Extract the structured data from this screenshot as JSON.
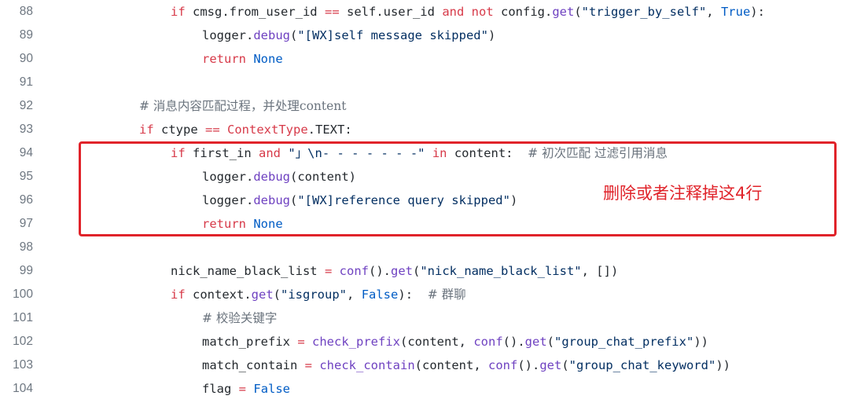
{
  "lines": [
    {
      "num": "88",
      "indent": 2,
      "tokens": [
        {
          "t": "if",
          "c": "kw"
        },
        {
          "t": " cmsg.from_user_id ",
          "c": ""
        },
        {
          "t": "==",
          "c": "op"
        },
        {
          "t": " self.user_id ",
          "c": ""
        },
        {
          "t": "and",
          "c": "kw"
        },
        {
          "t": " ",
          "c": ""
        },
        {
          "t": "not",
          "c": "kw"
        },
        {
          "t": " config.",
          "c": ""
        },
        {
          "t": "get",
          "c": "fn"
        },
        {
          "t": "(",
          "c": ""
        },
        {
          "t": "\"trigger_by_self\"",
          "c": "str"
        },
        {
          "t": ", ",
          "c": ""
        },
        {
          "t": "True",
          "c": "bi"
        },
        {
          "t": "):",
          "c": ""
        }
      ]
    },
    {
      "num": "89",
      "indent": 3,
      "tokens": [
        {
          "t": "logger.",
          "c": ""
        },
        {
          "t": "debug",
          "c": "fn"
        },
        {
          "t": "(",
          "c": ""
        },
        {
          "t": "\"[WX]self message skipped\"",
          "c": "str"
        },
        {
          "t": ")",
          "c": ""
        }
      ]
    },
    {
      "num": "90",
      "indent": 3,
      "tokens": [
        {
          "t": "return",
          "c": "kw"
        },
        {
          "t": " ",
          "c": ""
        },
        {
          "t": "None",
          "c": "bi"
        }
      ]
    },
    {
      "num": "91",
      "indent": 0,
      "tokens": []
    },
    {
      "num": "92",
      "indent": 1,
      "tokens": [
        {
          "t": "# 消息内容匹配过程，并处理content",
          "c": "cm"
        }
      ]
    },
    {
      "num": "93",
      "indent": 1,
      "tokens": [
        {
          "t": "if",
          "c": "kw"
        },
        {
          "t": " ctype ",
          "c": ""
        },
        {
          "t": "==",
          "c": "op"
        },
        {
          "t": " ",
          "c": ""
        },
        {
          "t": "ContextType",
          "c": "kw"
        },
        {
          "t": ".TEXT:",
          "c": ""
        }
      ]
    },
    {
      "num": "94",
      "indent": 2,
      "tokens": [
        {
          "t": "if",
          "c": "kw"
        },
        {
          "t": " first_in ",
          "c": ""
        },
        {
          "t": "and",
          "c": "kw"
        },
        {
          "t": " ",
          "c": ""
        },
        {
          "t": "\"」\\n- - - - - - -\"",
          "c": "str"
        },
        {
          "t": " ",
          "c": ""
        },
        {
          "t": "in",
          "c": "kw"
        },
        {
          "t": " content:  ",
          "c": ""
        },
        {
          "t": "# 初次匹配 过滤引用消息",
          "c": "cm"
        }
      ]
    },
    {
      "num": "95",
      "indent": 3,
      "tokens": [
        {
          "t": "logger.",
          "c": ""
        },
        {
          "t": "debug",
          "c": "fn"
        },
        {
          "t": "(content)",
          "c": ""
        }
      ]
    },
    {
      "num": "96",
      "indent": 3,
      "tokens": [
        {
          "t": "logger.",
          "c": ""
        },
        {
          "t": "debug",
          "c": "fn"
        },
        {
          "t": "(",
          "c": ""
        },
        {
          "t": "\"[WX]reference query skipped\"",
          "c": "str"
        },
        {
          "t": ")",
          "c": ""
        }
      ]
    },
    {
      "num": "97",
      "indent": 3,
      "tokens": [
        {
          "t": "return",
          "c": "kw"
        },
        {
          "t": " ",
          "c": ""
        },
        {
          "t": "None",
          "c": "bi"
        }
      ]
    },
    {
      "num": "98",
      "indent": 0,
      "tokens": []
    },
    {
      "num": "99",
      "indent": 2,
      "tokens": [
        {
          "t": "nick_name_black_list ",
          "c": ""
        },
        {
          "t": "=",
          "c": "op"
        },
        {
          "t": " ",
          "c": ""
        },
        {
          "t": "conf",
          "c": "fn"
        },
        {
          "t": "().",
          "c": ""
        },
        {
          "t": "get",
          "c": "fn"
        },
        {
          "t": "(",
          "c": ""
        },
        {
          "t": "\"nick_name_black_list\"",
          "c": "str"
        },
        {
          "t": ", [])",
          "c": ""
        }
      ]
    },
    {
      "num": "100",
      "indent": 2,
      "tokens": [
        {
          "t": "if",
          "c": "kw"
        },
        {
          "t": " context.",
          "c": ""
        },
        {
          "t": "get",
          "c": "fn"
        },
        {
          "t": "(",
          "c": ""
        },
        {
          "t": "\"isgroup\"",
          "c": "str"
        },
        {
          "t": ", ",
          "c": ""
        },
        {
          "t": "False",
          "c": "bi"
        },
        {
          "t": "):  ",
          "c": ""
        },
        {
          "t": "# 群聊",
          "c": "cm"
        }
      ]
    },
    {
      "num": "101",
      "indent": 3,
      "tokens": [
        {
          "t": "# 校验关键字",
          "c": "cm"
        }
      ]
    },
    {
      "num": "102",
      "indent": 3,
      "tokens": [
        {
          "t": "match_prefix ",
          "c": ""
        },
        {
          "t": "=",
          "c": "op"
        },
        {
          "t": " ",
          "c": ""
        },
        {
          "t": "check_prefix",
          "c": "fn"
        },
        {
          "t": "(content, ",
          "c": ""
        },
        {
          "t": "conf",
          "c": "fn"
        },
        {
          "t": "().",
          "c": ""
        },
        {
          "t": "get",
          "c": "fn"
        },
        {
          "t": "(",
          "c": ""
        },
        {
          "t": "\"group_chat_prefix\"",
          "c": "str"
        },
        {
          "t": "))",
          "c": ""
        }
      ]
    },
    {
      "num": "103",
      "indent": 3,
      "tokens": [
        {
          "t": "match_contain ",
          "c": ""
        },
        {
          "t": "=",
          "c": "op"
        },
        {
          "t": " ",
          "c": ""
        },
        {
          "t": "check_contain",
          "c": "fn"
        },
        {
          "t": "(content, ",
          "c": ""
        },
        {
          "t": "conf",
          "c": "fn"
        },
        {
          "t": "().",
          "c": ""
        },
        {
          "t": "get",
          "c": "fn"
        },
        {
          "t": "(",
          "c": ""
        },
        {
          "t": "\"group_chat_keyword\"",
          "c": "str"
        },
        {
          "t": "))",
          "c": ""
        }
      ]
    },
    {
      "num": "104",
      "indent": 3,
      "tokens": [
        {
          "t": "flag ",
          "c": ""
        },
        {
          "t": "=",
          "c": "op"
        },
        {
          "t": " ",
          "c": ""
        },
        {
          "t": "False",
          "c": "bi"
        }
      ]
    }
  ],
  "annotation": {
    "note": "删除或者注释掉这4行",
    "color": "#e0232a"
  }
}
